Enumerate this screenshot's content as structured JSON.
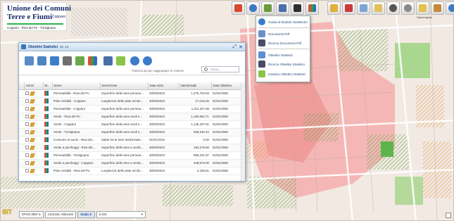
{
  "logo": {
    "line1": "Unione dei Comuni",
    "line2": "Terre e Fiumi",
    "line2_suffix": "Copparo",
    "municipalities": "Copparo - Riva del Po - Tresignana"
  },
  "map_label": "OpenLayers",
  "toolbar_icons": [
    "layers-icon",
    "info-icon",
    "measure-icon",
    "print-icon",
    "select-icon",
    "stats-icon",
    "pdf-icon",
    "edit-icon",
    "draw-icon",
    "pan-icon",
    "zoom-in-icon",
    "zoom-out-icon",
    "zoom-extent-icon",
    "bookmark-icon",
    "help-icon"
  ],
  "menu": {
    "items": [
      {
        "label": "Guida al Modulo Statistiche",
        "icon": "help-icon"
      },
      {
        "label": "Documenti Pdf",
        "icon": "pdf-doc-icon"
      },
      {
        "label": "Ricerca Documenti Pdf",
        "icon": "binoculars-icon"
      },
      {
        "label": "Obiettivi Statistici",
        "icon": "stats-doc-icon"
      },
      {
        "label": "Ricerca Obiettivi Statistici",
        "icon": "binoculars-icon"
      },
      {
        "label": "Inserisci Obiettivi Statistici",
        "icon": "add-icon"
      }
    ]
  },
  "window": {
    "title": "Obiettivi Statistici",
    "subtitle": "Nr. 14",
    "filter_hint": "Trascina qui per raggruppare le colonne",
    "search_placeholder": "Cerca...",
    "columns": [
      "",
      "Azioni",
      "M...",
      "Nome",
      "Descrizione",
      "Data Inizio",
      "Valorelnsale",
      "Data Obiettivo"
    ],
    "rows": [
      {
        "nome": "Permeabilità - Riva del Po",
        "descrizione": "Superficie delle aree permea...",
        "data_inizio": "30/03/2023",
        "valore": "1,375,753.83",
        "data_obiettivo": "01/01/2050"
      },
      {
        "nome": "Piste ciclabili - Copparo",
        "descrizione": "Lunghezza delle piste ed itin...",
        "data_inizio": "30/03/2023",
        "valore": "17,016.26",
        "data_obiettivo": "01/01/2050"
      },
      {
        "nome": "Permeabilità - Copparo",
        "descrizione": "Superficie delle aree permea...",
        "data_inizio": "30/03/2023",
        "valore": "1,311,327.98",
        "data_obiettivo": "01/01/2050"
      },
      {
        "nome": "Verde - Riva del Po",
        "descrizione": "Superficie delle aree verdi n...",
        "data_inizio": "30/03/2023",
        "valore": "1,150,062.71",
        "data_obiettivo": "01/01/2050"
      },
      {
        "nome": "Verde - Copparo",
        "descrizione": "Superficie delle aree verdi n...",
        "data_inizio": "30/03/2023",
        "valore": "1,128,337.61",
        "data_obiettivo": "01/01/2050"
      },
      {
        "nome": "Verde - Tresignana",
        "descrizione": "Superficie delle aree verdi n...",
        "data_inizio": "30/03/2023",
        "valore": "635,345.42",
        "data_obiettivo": "01/01/2050"
      },
      {
        "nome": "Consumo di suolo - Riva del...",
        "descrizione": "Saldo tra le aree trasformate...",
        "data_inizio": "01/01/2016",
        "valore": "0.00",
        "data_obiettivo": "01/01/2050"
      },
      {
        "nome": "Verde a parcheggi - Riva del...",
        "descrizione": "Superficie delle aree a verde...",
        "data_inizio": "30/03/2023",
        "valore": "184,276.60",
        "data_obiettivo": "01/01/2050"
      },
      {
        "nome": "Permeabilità - Tresignana",
        "descrizione": "Superficie delle aree permea...",
        "data_inizio": "30/03/2023",
        "valore": "956,341.97",
        "data_obiettivo": "01/01/2050"
      },
      {
        "nome": "Verde a parcheggi - Copparo",
        "descrizione": "Superficie delle aree a verde...",
        "data_inizio": "30/03/2023",
        "valore": "449,975.00",
        "data_obiettivo": "01/01/2050"
      },
      {
        "nome": "Piste ciclabili - Riva del Po",
        "descrizione": "Lunghezza delle piste ed itin...",
        "data_inizio": "30/03/2023",
        "valore": "2,155.61",
        "data_obiettivo": "01/01/2050"
      }
    ]
  },
  "bottom": {
    "brand": "SIT",
    "epsg": "EPSG:3857",
    "coords": "1315436, 5654194",
    "scale_label": "Scala 1:",
    "scale_value": "5.022"
  },
  "colors": {
    "map_bg": "#f1e9e2",
    "zone_pink": "#f4a6a6",
    "zone_green": "#8ccf6d",
    "zone_orange": "#f6b571",
    "window_title": "#15428b"
  }
}
